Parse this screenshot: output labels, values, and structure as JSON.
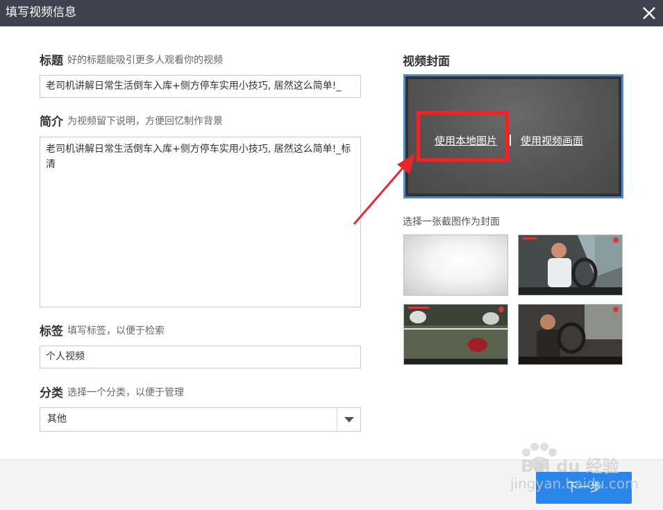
{
  "window": {
    "title": "填写视频信息",
    "close_icon": "close-icon"
  },
  "form": {
    "title": {
      "label": "标题",
      "hint": "好的标题能吸引更多人观看你的视频",
      "value": "老司机讲解日常生活倒车入库+侧方停车实用小技巧, 居然这么简单!_"
    },
    "description": {
      "label": "简介",
      "hint": "为视频留下说明，方便回忆制作背景",
      "value": "老司机讲解日常生活倒车入库+侧方停车实用小技巧, 居然这么简单!_标清"
    },
    "tags": {
      "label": "标签",
      "hint": "填写标签，以便于检索",
      "value": "个人视频"
    },
    "category": {
      "label": "分类",
      "hint": "选择一个分类，以便于管理",
      "value": "其他"
    }
  },
  "cover": {
    "title": "视频封面",
    "use_local_image": "使用本地图片",
    "use_video_frame": "使用视频画面",
    "thumb_hint": "选择一张截图作为封面"
  },
  "footer": {
    "next_label": "下一步"
  },
  "colors": {
    "titlebar": "#3d4450",
    "accent": "#2a86e8",
    "highlight": "#e8272b"
  },
  "watermark": {
    "text": "Bai du 经验",
    "sub": "jingyan.baidu.com"
  }
}
